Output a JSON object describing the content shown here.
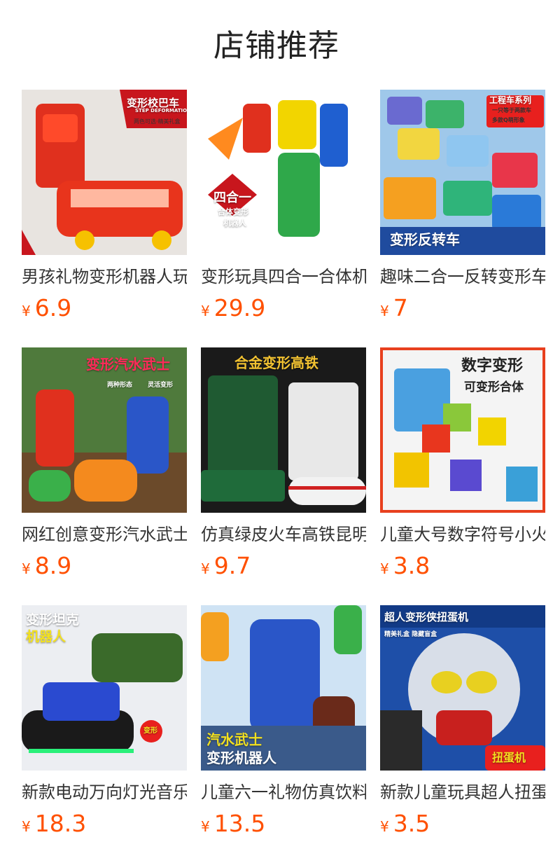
{
  "page": {
    "title": "店铺推荐"
  },
  "colors": {
    "price": "#ff5000",
    "title_text": "#333333",
    "heading": "#222222"
  },
  "products": [
    {
      "title": "男孩礼物变形机器人玩具",
      "currency": "¥",
      "price": "6.9",
      "image": {
        "badge": "变形校巴车",
        "subtitle": "STEP DEFORMATION",
        "tag": "两色可选·精美礼盒"
      }
    },
    {
      "title": "变形玩具四合一合体机器人",
      "currency": "¥",
      "price": "29.9",
      "image": {
        "badge": "四合一",
        "subtitle": "合体变形",
        "tag": "机器人"
      }
    },
    {
      "title": "趣味二合一反转变形车",
      "currency": "¥",
      "price": "7",
      "image": {
        "badge": "工程车系列",
        "subtitle": "一只等于两款车",
        "tag": "多款Q萌形象",
        "footer": "变形反转车"
      }
    },
    {
      "title": "网红创意变形汽水武士",
      "currency": "¥",
      "price": "8.9",
      "image": {
        "badge": "变形汽水武士",
        "subtitle": "两种形态",
        "tag": "灵活变形"
      }
    },
    {
      "title": "仿真绿皮火车高铁昆明",
      "currency": "¥",
      "price": "9.7",
      "image": {
        "badge": "合金变形高铁"
      }
    },
    {
      "title": "儿童大号数字符号小火车",
      "currency": "¥",
      "price": "3.8",
      "image": {
        "badge": "数字变形",
        "subtitle": "可变形合体"
      }
    },
    {
      "title": "新款电动万向灯光音乐坦克",
      "currency": "¥",
      "price": "18.3",
      "image": {
        "badge": "变形坦克",
        "subtitle": "机器人",
        "tag": "变形"
      }
    },
    {
      "title": "儿童六一礼物仿真饮料机器人",
      "currency": "¥",
      "price": "13.5",
      "image": {
        "badge": "汽水武士",
        "subtitle": "变形机器人"
      }
    },
    {
      "title": "新款儿童玩具超人扭蛋机",
      "currency": "¥",
      "price": "3.5",
      "image": {
        "badge": "超人变形侠扭蛋机",
        "subtitle": "精美礼盒 隐藏盲盒",
        "tag": "扭蛋机"
      }
    }
  ]
}
